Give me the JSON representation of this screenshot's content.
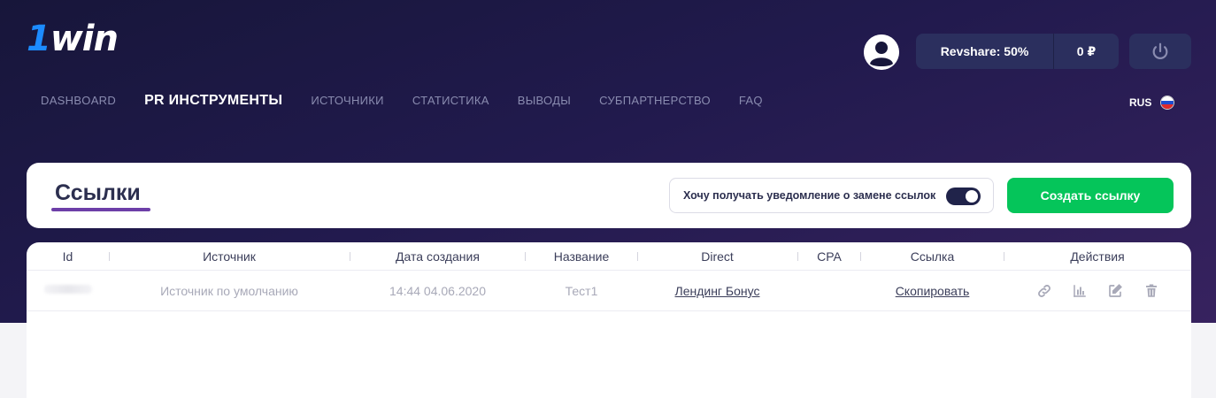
{
  "brand": {
    "logo_one": "1",
    "logo_rest": "win"
  },
  "header": {
    "revshare": "Revshare: 50%",
    "balance": "0 ₽",
    "language": "RUS"
  },
  "nav": [
    {
      "label": "DASHBOARD",
      "active": false
    },
    {
      "label": "PR ИНСТРУМЕНТЫ",
      "active": true
    },
    {
      "label": "ИСТОЧНИКИ",
      "active": false
    },
    {
      "label": "СТАТИСТИКА",
      "active": false
    },
    {
      "label": "ВЫВОДЫ",
      "active": false
    },
    {
      "label": "СУБПАРТНЕРСТВО",
      "active": false
    },
    {
      "label": "FAQ",
      "active": false
    }
  ],
  "links_panel": {
    "title": "Ссылки",
    "notify_label": "Хочу получать уведомление о замене ссылок",
    "notify_enabled": true,
    "create_button": "Создать ссылку"
  },
  "table": {
    "columns": [
      "Id",
      "Источник",
      "Дата создания",
      "Название",
      "Direct",
      "CPA",
      "Ссылка",
      "Действия"
    ],
    "rows": [
      {
        "source": "Источник по умолчанию",
        "created": "14:44 04.06.2020",
        "name": "Тест1",
        "direct": "Лендинг Бонус",
        "cpa": "",
        "link": "Скопировать",
        "actions": [
          "link-icon",
          "stats-icon",
          "edit-icon",
          "trash-icon"
        ]
      }
    ]
  },
  "colors": {
    "accent_green": "#05c55a",
    "header_dark": "#17163a",
    "header_purple": "#37225f",
    "underline": "#6d3fa8",
    "logo_blue": "#1c8bff"
  }
}
